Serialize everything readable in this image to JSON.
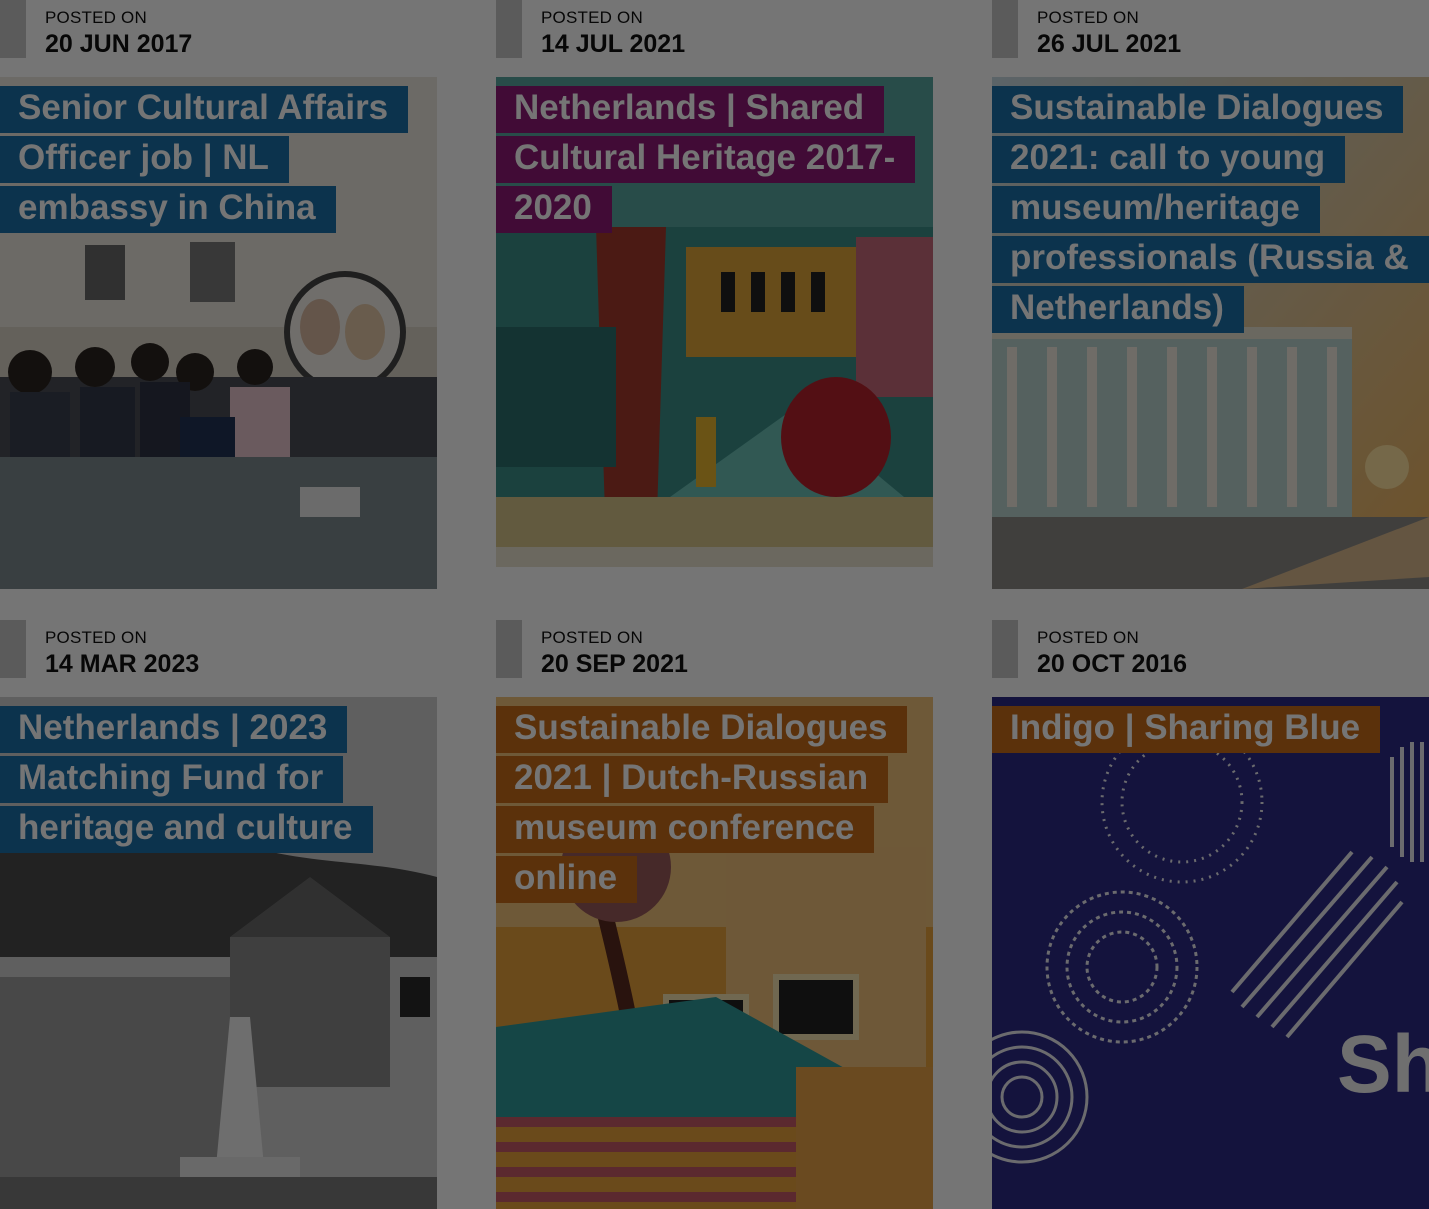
{
  "posts": [
    {
      "label": "POSTED ON",
      "date": "20 JUN 2017",
      "title": "Senior Cultural Affairs Officer job | NL embassy in China",
      "accent": "#1b6fa8",
      "image": "meeting-room-photo"
    },
    {
      "label": "POSTED ON",
      "date": "14 JUL 2021",
      "title": "Netherlands | Shared Cultural Heritage 2017-2020",
      "accent": "#8e1a76",
      "image": "mosaic-artwork"
    },
    {
      "label": "POSTED ON",
      "date": "26 JUL 2021",
      "title": "Sustainable Dialogues 2021: call to young museum/heritage professionals (Russia & Netherlands)",
      "accent": "#1b6fa8",
      "image": "hermitage-sunset-photo"
    },
    {
      "label": "POSTED ON",
      "date": "14 MAR 2023",
      "title": "Netherlands | 2023 Matching Fund for heritage and culture",
      "accent": "#1b6fa8",
      "image": "monument-bw-photo"
    },
    {
      "label": "POSTED ON",
      "date": "20 SEP 2021",
      "title": "Sustainable Dialogues 2021 | Dutch-Russian museum conference online",
      "accent": "#c66c1a",
      "image": "tapestry-artwork"
    },
    {
      "label": "POSTED ON",
      "date": "20 OCT 2016",
      "title": "Indigo | Sharing Blue",
      "accent": "#c66c1a",
      "image": "indigo-pattern-poster",
      "image_text": "Sh"
    }
  ],
  "colors": {
    "overlay": "rgba(0,0,0,0.54)",
    "meta_bar": "#c6c6c6"
  }
}
